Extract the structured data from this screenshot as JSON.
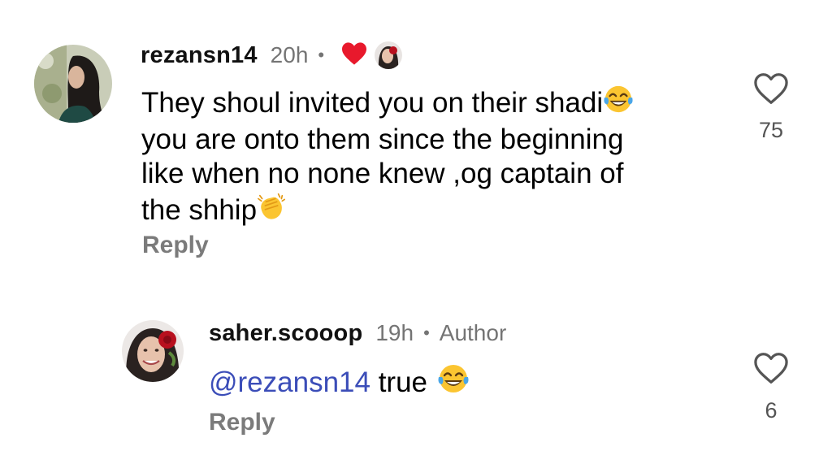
{
  "comments": [
    {
      "username": "rezansn14",
      "timestamp": "20h",
      "separator": "•",
      "text_lines": [
        "They shoul invited you on their shadi",
        "you are onto them since the beginning",
        "like when no none knew ,og captain of",
        "the shhip"
      ],
      "emojis": [
        "laughing-tears-emoji",
        "clapping-hands-emoji"
      ],
      "reply_label": "Reply",
      "like_count": "75",
      "liked_by_author": true
    },
    {
      "username": "saher.scooop",
      "timestamp": "19h",
      "separator": "•",
      "author_label": "Author",
      "mention": "@rezansn14",
      "text": " true",
      "emojis": [
        "laughing-tears-emoji"
      ],
      "reply_label": "Reply",
      "like_count": "6"
    }
  ],
  "icons": {
    "like": "heart-outline-icon",
    "author_liked": "red-heart-icon"
  },
  "colors": {
    "text": "#000000",
    "meta": "#747474",
    "reply": "#7b7b7b",
    "mention": "#3b4db8",
    "heart_red": "#e8192c"
  }
}
